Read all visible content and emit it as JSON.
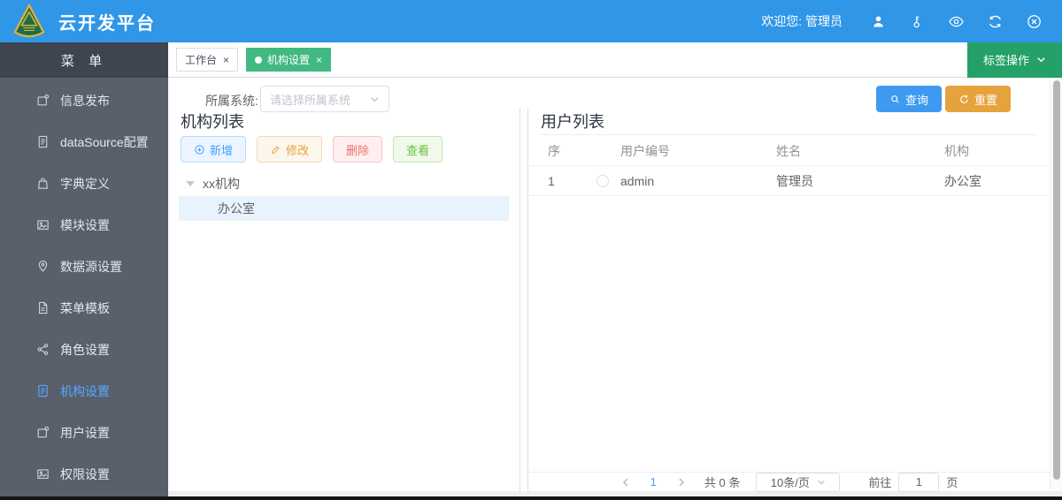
{
  "header": {
    "title": "云开发平台",
    "welcome": "欢迎您: 管理员"
  },
  "sidebar": {
    "title": "菜 单",
    "items": [
      {
        "label": "信息发布",
        "icon": "copy-icon",
        "active": false
      },
      {
        "label": "dataSource配置",
        "icon": "document-icon",
        "active": false
      },
      {
        "label": "字典定义",
        "icon": "bag-icon",
        "active": false
      },
      {
        "label": "模块设置",
        "icon": "image-icon",
        "active": false
      },
      {
        "label": "数据源设置",
        "icon": "location-icon",
        "active": false
      },
      {
        "label": "菜单模板",
        "icon": "file-icon",
        "active": false
      },
      {
        "label": "角色设置",
        "icon": "share-icon",
        "active": false
      },
      {
        "label": "机构设置",
        "icon": "file-lines-icon",
        "active": true
      },
      {
        "label": "用户设置",
        "icon": "copy-icon",
        "active": false
      },
      {
        "label": "权限设置",
        "icon": "image-icon",
        "active": false
      }
    ]
  },
  "tabbar": {
    "tabs": [
      {
        "label": "工作台",
        "active": false
      },
      {
        "label": "机构设置",
        "active": true
      }
    ],
    "actions_button": "标签操作"
  },
  "filter": {
    "label": "所属系统:",
    "placeholder": "请选择所属系统",
    "search": "查询",
    "reset": "重置"
  },
  "org_panel": {
    "title": "机构列表",
    "buttons": [
      {
        "label": "新增",
        "type": "primary"
      },
      {
        "label": "修改",
        "type": "warning"
      },
      {
        "label": "删除",
        "type": "danger"
      },
      {
        "label": "查看",
        "type": "success"
      }
    ],
    "tree": {
      "root": "xx机构",
      "children": [
        "办公室"
      ],
      "selected": "办公室"
    }
  },
  "user_panel": {
    "title": "用户列表",
    "columns": [
      "序",
      "用户编号",
      "姓名",
      "机构"
    ],
    "rows": [
      {
        "seq": "1",
        "code": "admin",
        "name": "管理员",
        "org": "办公室"
      }
    ]
  },
  "pagination": {
    "current": "1",
    "total": "共 0 条",
    "page_size": "10条/页",
    "goto_label": "前往",
    "goto_value": "1",
    "page_label": "页"
  },
  "icons": {
    "close": "×"
  },
  "colors": {
    "header_blue": "#2f96e8",
    "sidebar_dark": "#59606c",
    "sidebar_head": "#3e4551",
    "active_tab_green": "#42b983",
    "tag_actions_green": "#24a169",
    "primary": "#409eff",
    "warning": "#e6a23c",
    "danger": "#f56c6c",
    "success": "#67c23a",
    "selected_tree_bg": "#e9f3fd"
  }
}
